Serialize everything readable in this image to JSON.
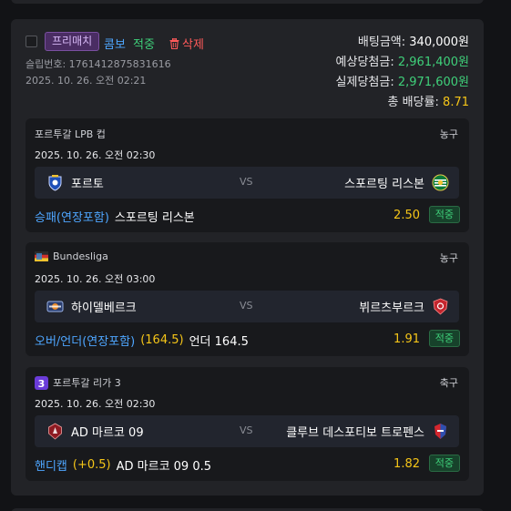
{
  "slip": {
    "badge_free": "프리매치",
    "badge_combo": "콤보",
    "badge_hit": "적중",
    "delete_label": "삭제",
    "slip_no_label": "슬립번호: 1761412875831616",
    "slip_time": "2025. 10. 26. 오전 02:21",
    "bet_amount_label": "배팅금액:",
    "bet_amount_value": "340,000원",
    "expected_win_label": "예상당첨금:",
    "expected_win_value": "2,961,400원",
    "actual_win_label": "실제당첨금:",
    "actual_win_value": "2,971,600원",
    "total_odds_label": "총 배당률:",
    "total_odds_value": "8.71"
  },
  "games": [
    {
      "league": "포르투갈 LPB 컵",
      "league_icon": "none",
      "sport": "농구",
      "time": "2025. 10. 26. 오전 02:30",
      "home": "포르토",
      "home_logo": "porto-crest-icon",
      "vs": "VS",
      "away": "스포르팅 리스본",
      "away_logo": "sporting-crest-icon",
      "market": "승패(연장포함)",
      "handicap": "",
      "selection": "스포르팅 리스본",
      "odds": "2.50",
      "result": "적중"
    },
    {
      "league": "Bundesliga",
      "league_icon": "germany-flag-icon",
      "sport": "농구",
      "time": "2025. 10. 26. 오전 03:00",
      "home": "하이델베르크",
      "home_logo": "heidelberg-logo-icon",
      "vs": "VS",
      "away": "뷔르츠부르크",
      "away_logo": "wurzburg-logo-icon",
      "market": "오버/언더(연장포함)",
      "handicap": "(164.5)",
      "selection": "언더 164.5",
      "odds": "1.91",
      "result": "적중"
    },
    {
      "league": "포르투갈 리가 3",
      "league_icon": "liga3-logo-icon",
      "sport": "축구",
      "time": "2025. 10. 26. 오전 02:30",
      "home": "AD 마르코 09",
      "home_logo": "marco-crest-icon",
      "vs": "VS",
      "away": "클루브 데스포티보 트로펜스",
      "away_logo": "trofense-crest-icon",
      "market": "핸디캡",
      "handicap": "(+0.5)",
      "selection": "AD 마르코 09 0.5",
      "odds": "1.82",
      "result": "적중"
    }
  ]
}
